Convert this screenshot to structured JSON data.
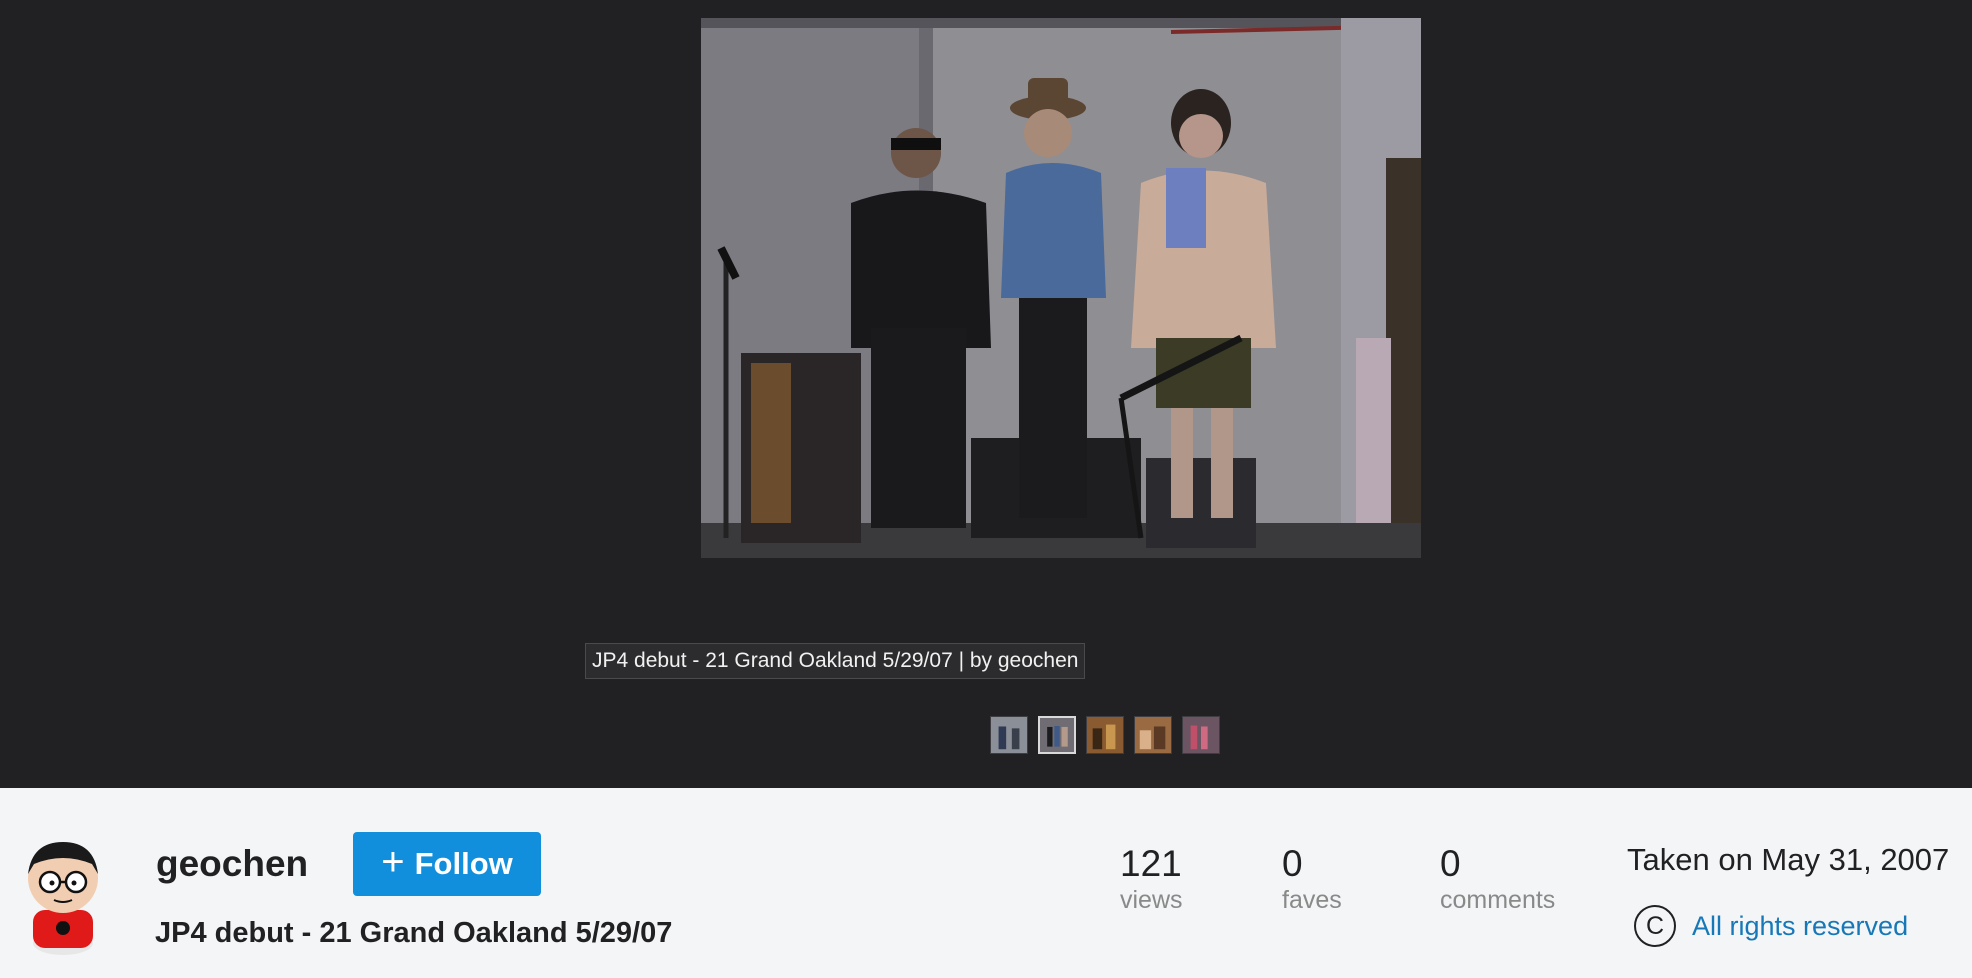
{
  "photo": {
    "alt": "JP4 debut - 21 Grand Oakland 5/29/07"
  },
  "tooltip": "JP4 debut - 21 Grand Oakland 5/29/07 | by geochen",
  "thumbnails": [
    "thumb-1",
    "thumb-2",
    "thumb-3",
    "thumb-4",
    "thumb-5"
  ],
  "owner": {
    "name": "geochen"
  },
  "follow_button": {
    "plus": "+",
    "label": "Follow"
  },
  "title": "JP4 debut - 21 Grand Oakland 5/29/07",
  "stats": {
    "views": {
      "value": "121",
      "label": "views"
    },
    "faves": {
      "value": "0",
      "label": "faves"
    },
    "comments": {
      "value": "0",
      "label": "comments"
    }
  },
  "taken": "Taken on May 31, 2007",
  "license": {
    "icon": "C",
    "label": "All rights reserved"
  },
  "colors": {
    "viewer_bg": "#212124",
    "footer_bg": "#f3f5f6",
    "accent": "#128fdc",
    "link": "#1778b8"
  }
}
